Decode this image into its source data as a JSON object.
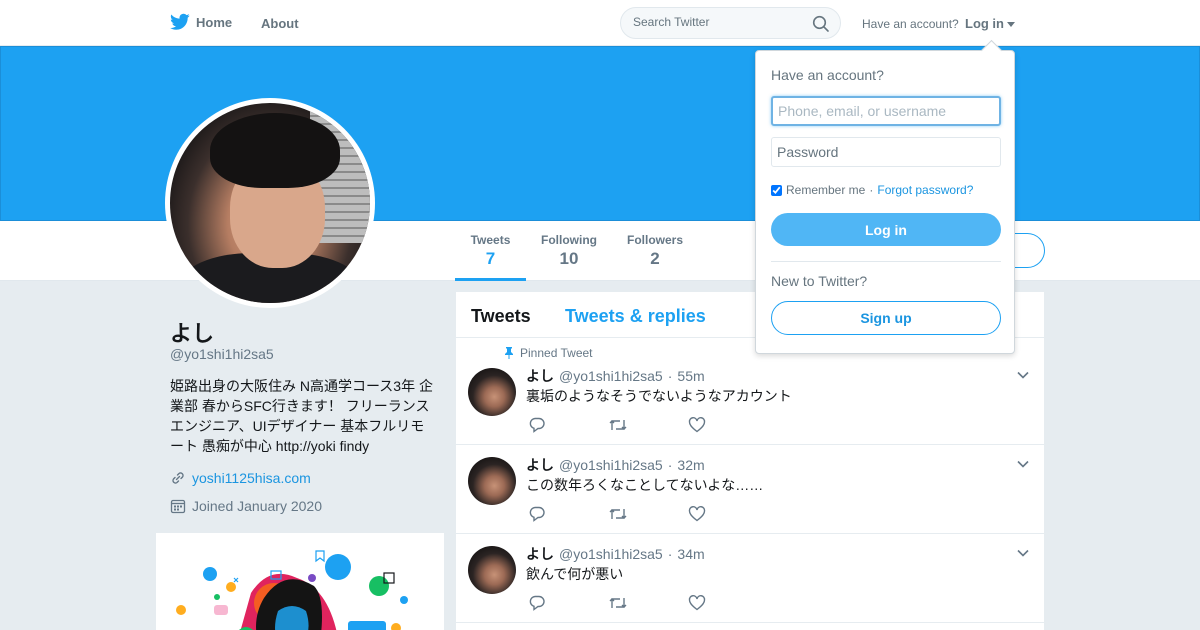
{
  "nav": {
    "home_label": "Home",
    "about_label": "About",
    "search_placeholder": "Search Twitter",
    "have_account": "Have an account?",
    "login_label": "Log in"
  },
  "profile": {
    "name": "よし",
    "handle": "@yo1shi1hi2sa5",
    "bio": "姫路出身の大阪住み N高通学コース3年 企業部 春からSFC行きます！ フリーランスエンジニア、UIデザイナー 基本フルリモート 愚痴が中心 http://yoki findy",
    "url": "yoshi1125hisa.com",
    "joined": "Joined January 2020"
  },
  "stats": [
    {
      "label": "Tweets",
      "value": "7"
    },
    {
      "label": "Following",
      "value": "10"
    },
    {
      "label": "Followers",
      "value": "2"
    }
  ],
  "timeline": {
    "tab_tweets": "Tweets",
    "tab_replies": "Tweets & replies",
    "pinned_label": "Pinned Tweet",
    "tweets": [
      {
        "name": "よし",
        "handle": "@yo1shi1hi2sa5",
        "time": "55m",
        "text": "裏垢のようなそうでないようなアカウント"
      },
      {
        "name": "よし",
        "handle": "@yo1shi1hi2sa5",
        "time": "32m",
        "text": "この数年ろくなことしてないよな……"
      },
      {
        "name": "よし",
        "handle": "@yo1shi1hi2sa5",
        "time": "34m",
        "text": "飲んで何が悪い"
      }
    ]
  },
  "login_dropdown": {
    "title": "Have an account?",
    "username_placeholder": "Phone, email, or username",
    "password_placeholder": "Password",
    "remember_label": "Remember me",
    "separator": "·",
    "forgot_label": "Forgot password?",
    "login_button": "Log in",
    "new_label": "New to Twitter?",
    "signup_button": "Sign up"
  },
  "colors": {
    "brand_blue": "#1da1f2",
    "link_blue": "#1b95e0",
    "secondary_text": "#657786",
    "background": "#e6ecf0"
  },
  "icons": [
    "twitter-bird-icon",
    "search-icon",
    "pin-icon",
    "link-icon",
    "calendar-icon",
    "reply-icon",
    "retweet-icon",
    "like-icon",
    "chevron-down-icon"
  ]
}
